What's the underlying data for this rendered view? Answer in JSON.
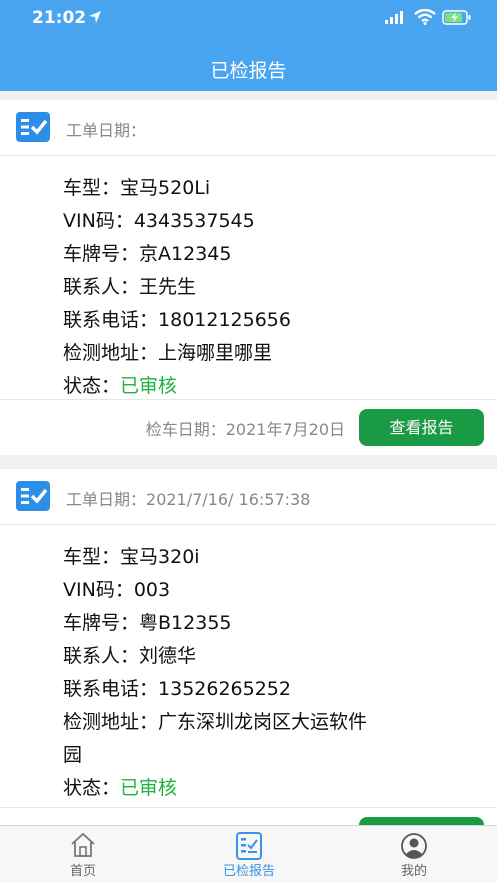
{
  "status_bar": {
    "time": "21:02"
  },
  "header": {
    "title": "已检报告"
  },
  "cards": [
    {
      "order_date_label": "工单日期：",
      "order_date": "",
      "fields": [
        {
          "label": "车型：",
          "value": "宝马520Li"
        },
        {
          "label": "VIN码：",
          "value": "4343537545"
        },
        {
          "label": "车牌号：",
          "value": "京A12345"
        },
        {
          "label": "联系人：",
          "value": "王先生"
        },
        {
          "label": "联系电话：",
          "value": "18012125656"
        },
        {
          "label": "检测地址：",
          "value": "上海哪里哪里"
        },
        {
          "label": "状态：",
          "value": "已审核"
        }
      ],
      "inspect_date": "检车日期：2021年7月20日",
      "report_button": "查看报告"
    },
    {
      "order_date_label": "工单日期：",
      "order_date": "2021/7/16/ 16:57:38",
      "fields": [
        {
          "label": "车型：",
          "value": "宝马320i"
        },
        {
          "label": "VIN码：",
          "value": "003"
        },
        {
          "label": "车牌号：",
          "value": "粤B12355"
        },
        {
          "label": "联系人：",
          "value": "刘德华"
        },
        {
          "label": "联系电话：",
          "value": "13526265252"
        },
        {
          "label": "检测地址：",
          "value": "广东深圳龙岗区大运软件"
        },
        {
          "label": "",
          "value": "园"
        },
        {
          "label": "状态：",
          "value": "已审核"
        }
      ]
    }
  ],
  "tabs": [
    {
      "label": "首页",
      "icon": "home-icon"
    },
    {
      "label": "已检报告",
      "icon": "report-icon"
    },
    {
      "label": "我的",
      "icon": "user-icon"
    }
  ],
  "colors": {
    "header_bg": "#4aa5f0",
    "status_ok": "#1db33c",
    "button_bg": "#1b9a45",
    "tab_active": "#3a93e6"
  }
}
